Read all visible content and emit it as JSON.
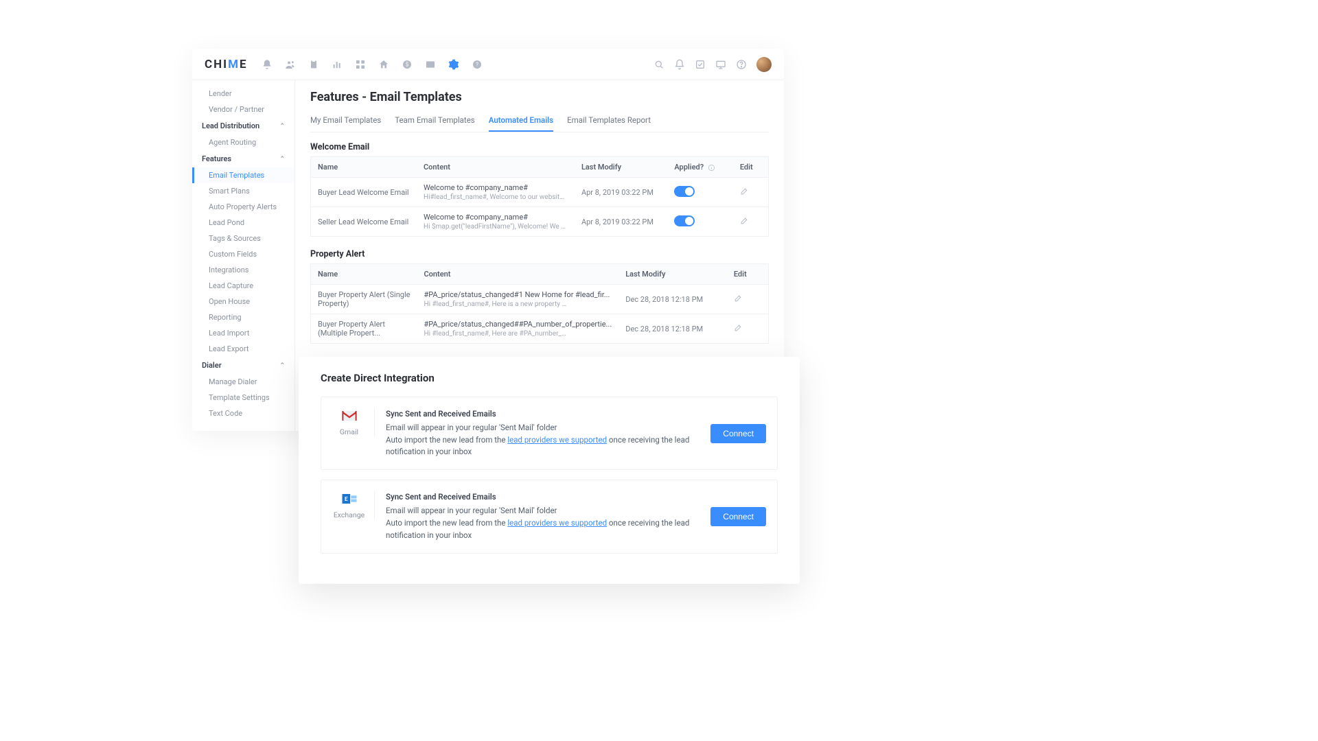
{
  "logo": {
    "pre": "CHI",
    "accent": "M",
    "post": "E"
  },
  "page_title": "Features - Email Templates",
  "tabs": [
    {
      "label": "My Email Templates"
    },
    {
      "label": "Team Email Templates"
    },
    {
      "label": "Automated Emails"
    },
    {
      "label": "Email Templates Report"
    }
  ],
  "sidebar": {
    "top_items": [
      "Lender",
      "Vendor / Partner"
    ],
    "groups": [
      {
        "title": "Lead Distribution",
        "items": [
          "Agent Routing"
        ]
      },
      {
        "title": "Features",
        "items": [
          "Email Templates",
          "Smart Plans",
          "Auto Property Alerts",
          "Lead Pond",
          "Tags & Sources",
          "Custom Fields",
          "Integrations",
          "Lead Capture",
          "Open House",
          "Reporting",
          "Lead Import",
          "Lead Export"
        ]
      },
      {
        "title": "Dialer",
        "items": [
          "Manage Dialer",
          "Template Settings",
          "Text Code"
        ]
      }
    ]
  },
  "sections": {
    "welcome": {
      "title": "Welcome Email",
      "headers": {
        "name": "Name",
        "content": "Content",
        "modify": "Last Modify",
        "applied": "Applied?",
        "edit": "Edit"
      },
      "rows": [
        {
          "name": "Buyer Lead Welcome Email",
          "content_title": "Welcome to #company_name#",
          "content_sub": "Hi#lead_first_name#,  Welcome to our website...",
          "modify": "Apr 8, 2019 03:22 PM"
        },
        {
          "name": "Seller Lead Welcome Email",
          "content_title": "Welcome to #company_name#",
          "content_sub": "Hi $map.get(\"leadFirstName\"), Welcome! We t...",
          "modify": "Apr 8, 2019 03:22 PM"
        }
      ]
    },
    "property": {
      "title": "Property Alert",
      "headers": {
        "name": "Name",
        "content": "Content",
        "modify": "Last Modify",
        "edit": "Edit"
      },
      "rows": [
        {
          "name": "Buyer Property Alert (Single Property)",
          "content_title": "#PA_price/status_changed#1 New Home for #lead_fir...",
          "content_sub": "Hi #lead_first_name#, Here is a new property matching your s...",
          "modify": "Dec 28, 2018 12:18 PM"
        },
        {
          "name": "Buyer Property Alert (Multiple Propert...",
          "content_title": "#PA_price/status_changed##PA_number_of_propertie...",
          "content_sub": "Hi #lead_first_name#, Here are #PA_number_of_properties# n...",
          "modify": "Dec 28, 2018 12:18 PM"
        }
      ]
    }
  },
  "integration": {
    "title": "Create Direct Integration",
    "providers": [
      {
        "name": "Gmail",
        "headline": "Sync Sent and Received Emails",
        "line1": "Email will appear in your regular 'Sent Mail' folder",
        "line2_pre": "Auto import the new lead from the ",
        "line2_link": "lead providers we supported",
        "line2_post": " once receiving the lead notification in your inbox",
        "button": "Connect"
      },
      {
        "name": "Exchange",
        "headline": "Sync Sent and Received Emails",
        "line1": "Email will appear in your regular 'Sent Mail' folder",
        "line2_pre": "Auto import the new lead from the ",
        "line2_link": "lead providers we supported",
        "line2_post": " once receiving the lead notification in your inbox",
        "button": "Connect"
      }
    ]
  }
}
